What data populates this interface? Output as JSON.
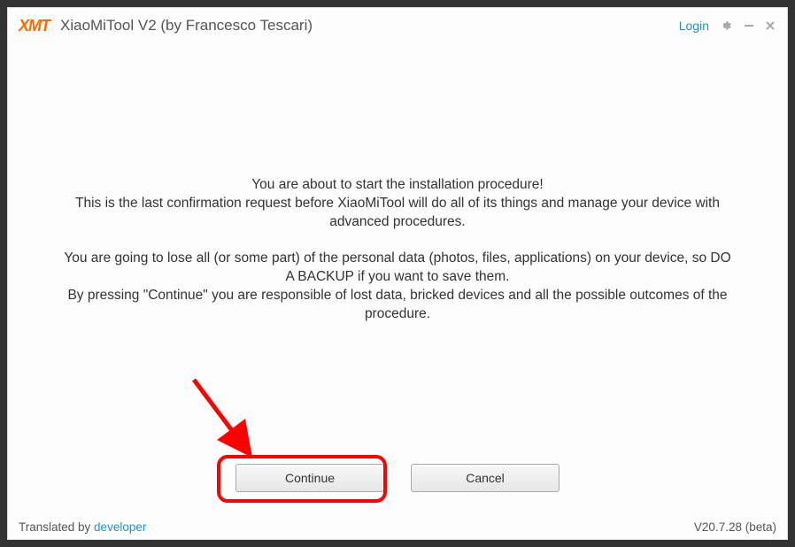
{
  "header": {
    "logo": "XMT",
    "title": "XiaoMiTool V2 (by Francesco Tescari)",
    "login": "Login"
  },
  "message": {
    "line1": "You are about to start the installation procedure!",
    "line2": "This is the last confirmation request before XiaoMiTool will do all of its things and manage your device with advanced procedures.",
    "line3": "You are going to lose all (or some part) of the personal data (photos, files, applications) on your device, so DO A BACKUP if you want to save them.",
    "line4": "By pressing \"Continue\" you are responsible of lost data, bricked devices and all the possible outcomes of the procedure."
  },
  "buttons": {
    "continue": "Continue",
    "cancel": "Cancel"
  },
  "footer": {
    "translated_by": "Translated by ",
    "developer": "developer",
    "version": "V20.7.28 (beta)"
  }
}
